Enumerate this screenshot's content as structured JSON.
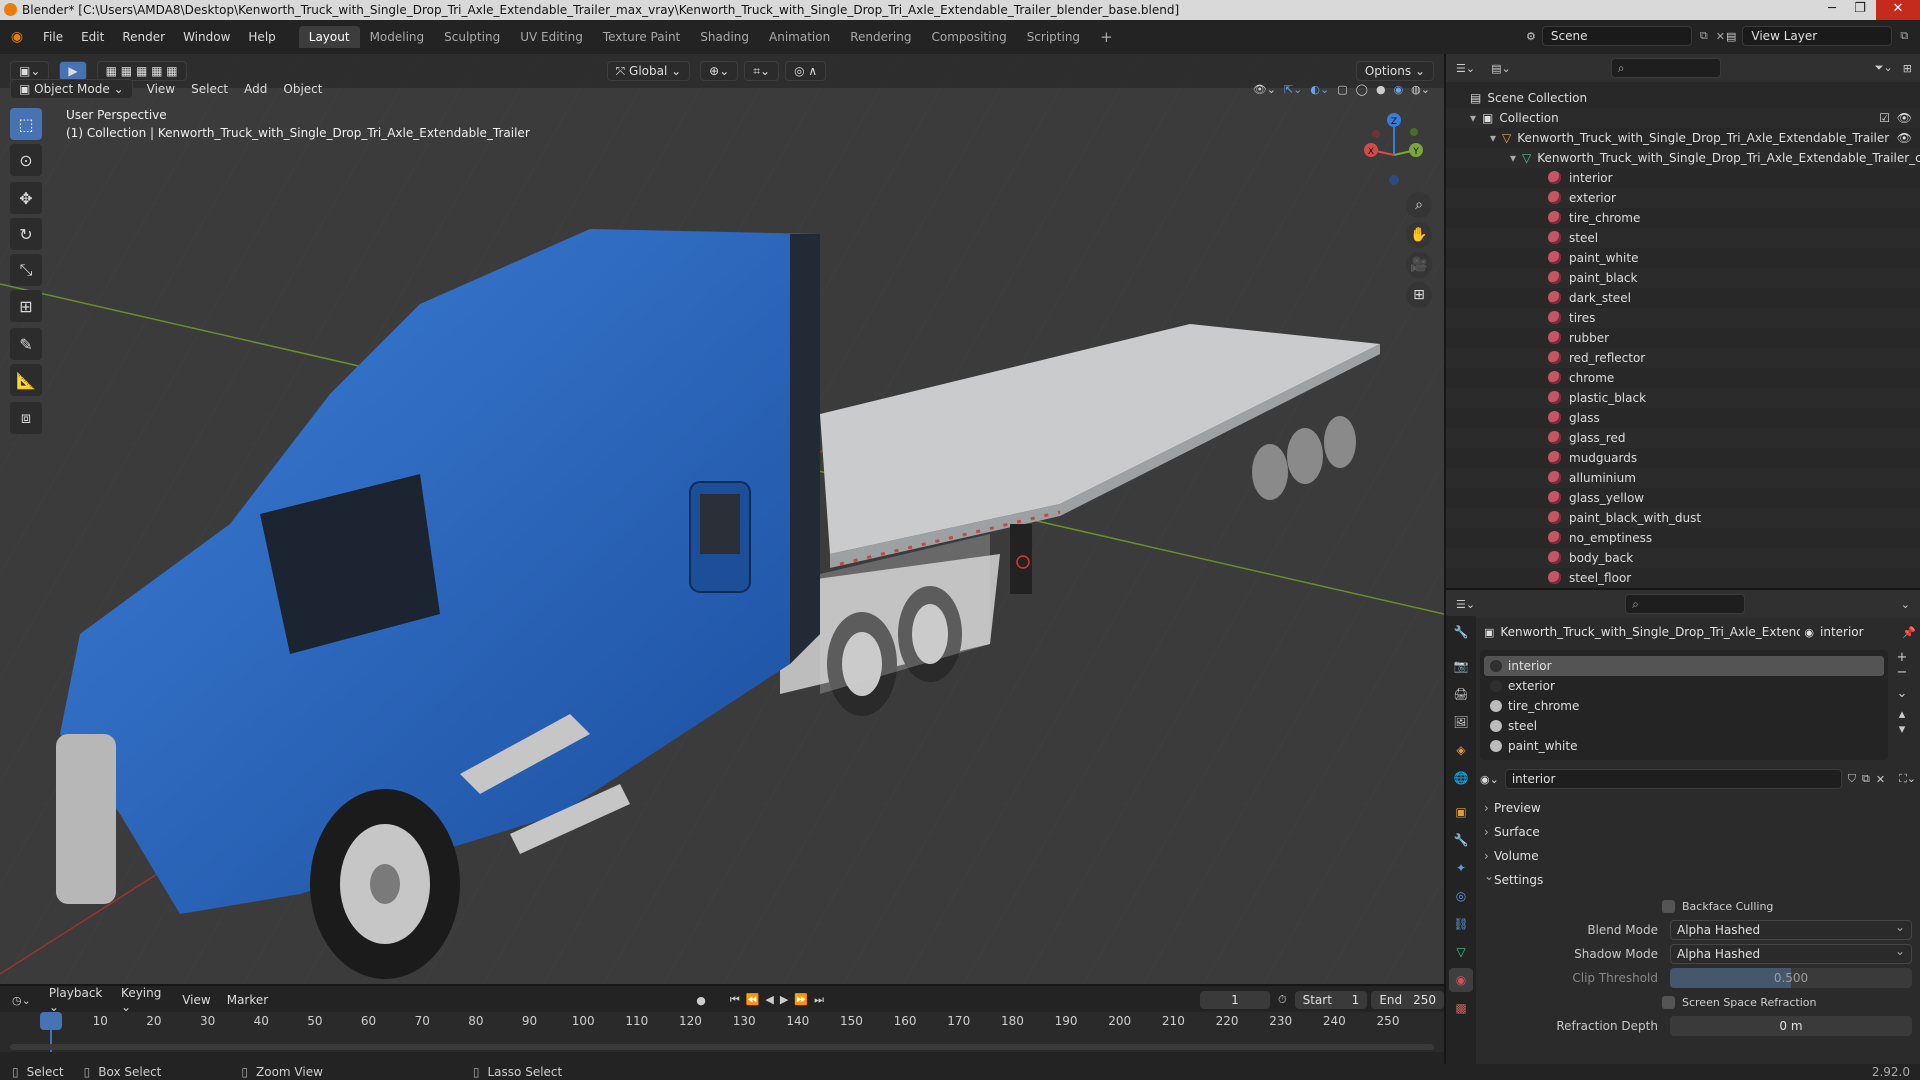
{
  "window": {
    "title": "Blender* [C:\\Users\\AMDA8\\Desktop\\Kenworth_Truck_with_Single_Drop_Tri_Axle_Extendable_Trailer_max_vray\\Kenworth_Truck_with_Single_Drop_Tri_Axle_Extendable_Trailer_blender_base.blend]"
  },
  "menubar": {
    "items": [
      "File",
      "Edit",
      "Render",
      "Window",
      "Help"
    ],
    "workspaces": [
      "Layout",
      "Modeling",
      "Sculpting",
      "UV Editing",
      "Texture Paint",
      "Shading",
      "Animation",
      "Rendering",
      "Compositing",
      "Scripting"
    ],
    "active_workspace": "Layout",
    "scene": "Scene",
    "view_layer": "View Layer"
  },
  "viewport": {
    "orientation": "Global",
    "options_label": "Options",
    "mode": "Object Mode",
    "menus": [
      "View",
      "Select",
      "Add",
      "Object"
    ],
    "info_line1": "User Perspective",
    "info_line2": "(1) Collection | Kenworth_Truck_with_Single_Drop_Tri_Axle_Extendable_Trailer",
    "gizmo": {
      "x": "X",
      "y": "Y",
      "z": "Z"
    }
  },
  "outliner": {
    "scene_collection": "Scene Collection",
    "collection": "Collection",
    "object": "Kenworth_Truck_with_Single_Drop_Tri_Axle_Extendable_Trailer",
    "mesh": "Kenworth_Truck_with_Single_Drop_Tri_Axle_Extendable_Trailer_c",
    "materials": [
      "interior",
      "exterior",
      "tire_chrome",
      "steel",
      "paint_white",
      "paint_black",
      "dark_steel",
      "tires",
      "rubber",
      "red_reflector",
      "chrome",
      "plastic_black",
      "glass",
      "glass_red",
      "mudguards",
      "alluminium",
      "glass_yellow",
      "paint_black_with_dust",
      "no_emptiness",
      "body_back",
      "steel_floor"
    ]
  },
  "properties": {
    "object_name": "Kenworth_Truck_with_Single_Drop_Tri_Axle_Extendable_...",
    "material_name": "interior",
    "slots": [
      "interior",
      "exterior",
      "tire_chrome",
      "steel",
      "paint_white"
    ],
    "selected_slot": "interior",
    "material_field": "interior",
    "panels": [
      "Preview",
      "Surface",
      "Volume",
      "Settings"
    ],
    "settings": {
      "backface_culling": "Backface Culling",
      "blend_mode_label": "Blend Mode",
      "blend_mode": "Alpha Hashed",
      "shadow_mode_label": "Shadow Mode",
      "shadow_mode": "Alpha Hashed",
      "clip_threshold_label": "Clip Threshold",
      "clip_threshold": "0.500",
      "ssr": "Screen Space Refraction",
      "refraction_depth_label": "Refraction Depth",
      "refraction_depth": "0 m"
    }
  },
  "timeline": {
    "menus": [
      "Playback",
      "Keying",
      "View",
      "Marker"
    ],
    "current_frame": "1",
    "start_label": "Start",
    "start": "1",
    "end_label": "End",
    "end": "250",
    "ticks": [
      "1",
      "10",
      "20",
      "30",
      "40",
      "50",
      "60",
      "70",
      "80",
      "90",
      "100",
      "110",
      "120",
      "130",
      "140",
      "150",
      "160",
      "170",
      "180",
      "190",
      "200",
      "210",
      "220",
      "230",
      "240",
      "250"
    ]
  },
  "statusbar": {
    "select": "Select",
    "box_select": "Box Select",
    "zoom_view": "Zoom View",
    "lasso_select": "Lasso Select",
    "version": "2.92.0"
  }
}
